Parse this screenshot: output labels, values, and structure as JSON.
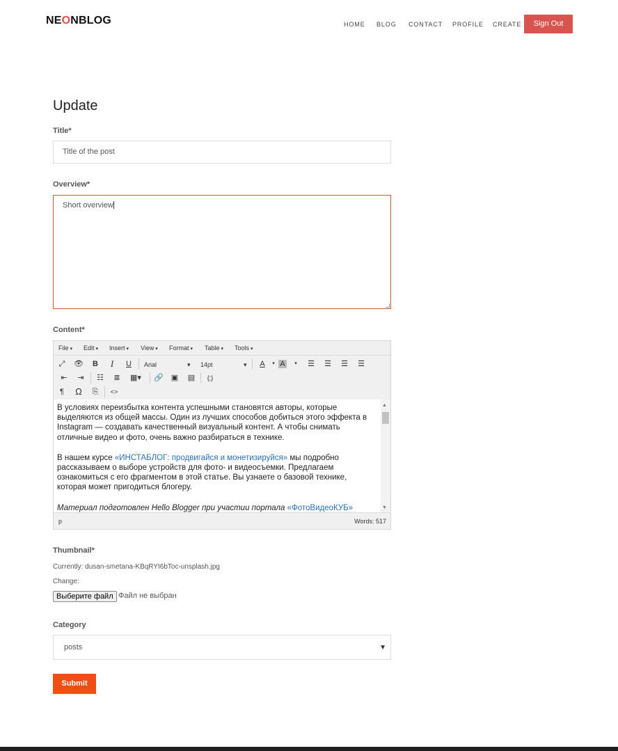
{
  "brand": {
    "prefix": "NE",
    "accent": "O",
    "suffix": "NBLOG",
    "accent_color": "#e84b4b"
  },
  "nav": {
    "home": "HOME",
    "blog": "BLOG",
    "contact": "CONTACT",
    "profile": "PROFILE",
    "create": "CREATE",
    "signout": "Sign Out"
  },
  "form": {
    "heading": "Update",
    "title_label": "Title*",
    "title_value": "Title of the post",
    "overview_label": "Overview*",
    "overview_value": "Short overview",
    "content_label": "Content*",
    "thumbnail_label": "Thumbnail*",
    "currently_label": "Currently:",
    "currently_file": "dusan-smetana-KBqRYI6bToc-unsplash.jpg",
    "change_label": "Change:",
    "file_button": "Выберите файл",
    "file_status": "Файл не выбран",
    "category_label": "Category",
    "category_value": "posts",
    "submit": "Submit"
  },
  "editor": {
    "menu": [
      "File",
      "Edit",
      "Insert",
      "View",
      "Format",
      "Table",
      "Tools"
    ],
    "font_family": "Arial",
    "font_size": "14pt",
    "status_path": "p",
    "word_count": "Words: 517",
    "paragraph1": "В условиях переизбытка контента успешными становятся авторы, которые выделяются из общей массы. Один из лучших способов добиться этого эффекта в Instagram — создавать качественный визуальный контент. А чтобы снимать отличные видео и фото, очень важно разбираться в технике.",
    "p2_before": "В нашем курсе ",
    "p2_link": "«ИНСТАБЛОГ: продвигайся и монетизируйся»",
    "p2_after": " мы подробно рассказываем о выборе устройств для фото- и видеосъемки. Предлагаем ознакомиться с его фрагментом в этой статье. Вы узнаете о базовой технике, которая может пригодиться блогеру.",
    "p3_before": "Материал подготовлен Hello Blogger при участии портала ",
    "p3_link": "«ФотоВидеоКУБ»"
  },
  "colors": {
    "signout_bg": "#d9534f",
    "submit_bg": "#f04e13",
    "overview_border": "#c75a2e",
    "link": "#2a6fb5"
  }
}
